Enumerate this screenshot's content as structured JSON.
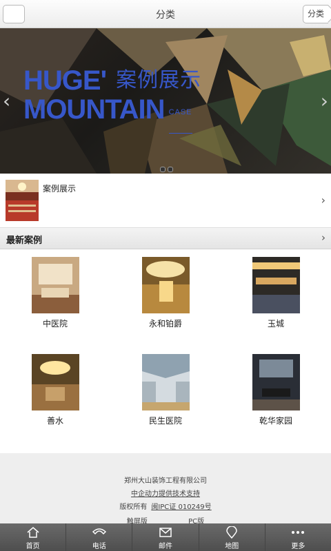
{
  "header": {
    "title": "分类",
    "category_label": "分类"
  },
  "banner": {
    "word1": "HUGE'",
    "cn_title": "案例展示",
    "word2": "MOUNTAIN",
    "case_word": "CASE"
  },
  "featured": {
    "label": "案例展示"
  },
  "section": {
    "title": "最新案例"
  },
  "cases": [
    {
      "name": "中医院"
    },
    {
      "name": "永和铂爵"
    },
    {
      "name": "玉城"
    },
    {
      "name": "善水"
    },
    {
      "name": "民生医院"
    },
    {
      "name": "乾华家园"
    }
  ],
  "footer": {
    "company": "郑州大山装饰工程有限公司",
    "support": "中企动力提供技术支持",
    "copyright": "版权所有",
    "icp": "闽IPC证 010249号",
    "touch_version": "触屏版",
    "pc_version": "PC版"
  },
  "tabs": [
    {
      "label": "首页",
      "icon": "home-icon"
    },
    {
      "label": "电话",
      "icon": "phone-icon"
    },
    {
      "label": "邮件",
      "icon": "mail-icon"
    },
    {
      "label": "地图",
      "icon": "map-pin-icon"
    },
    {
      "label": "更多",
      "icon": "more-icon"
    }
  ],
  "colors": {
    "brand_blue": "#3757c9",
    "tabbar": "#5a5a5a",
    "footer_bg": "#eeeeee"
  }
}
